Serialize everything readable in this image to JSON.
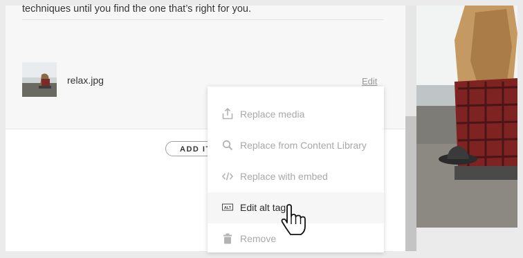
{
  "card": {
    "description": "techniques until you find the one that’s right for you.",
    "file_name": "relax.jpg",
    "edit_label": "Edit"
  },
  "add_item": {
    "label": "ADD IT"
  },
  "media_menu": {
    "items": [
      {
        "label": "Replace media",
        "icon": "upload-icon"
      },
      {
        "label": "Replace from Content Library",
        "icon": "search-icon"
      },
      {
        "label": "Replace with embed",
        "icon": "code-icon"
      },
      {
        "label": "Edit alt tag",
        "icon": "alt-tag-icon",
        "hovered": true
      },
      {
        "label": "Remove",
        "icon": "trash-icon"
      }
    ]
  },
  "colors": {
    "menu_text": "#a8a8a8",
    "menu_text_hover": "#2b2b2b",
    "card_background": "#f7f7f7"
  }
}
